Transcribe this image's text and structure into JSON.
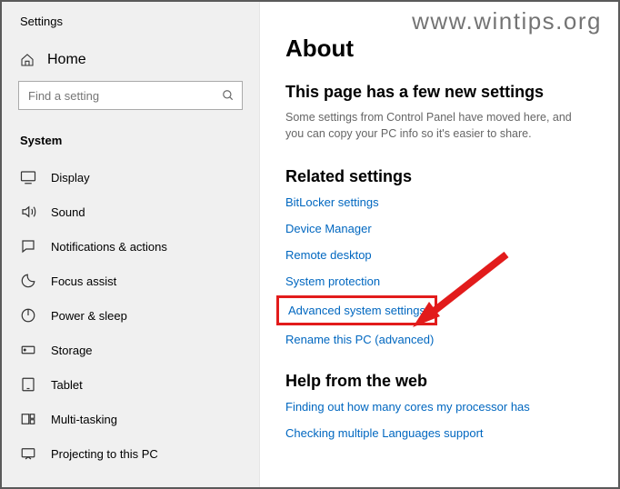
{
  "watermark": "www.wintips.org",
  "sidebar": {
    "title": "Settings",
    "home_label": "Home",
    "search_placeholder": "Find a setting",
    "group_header": "System",
    "items": [
      {
        "label": "Display"
      },
      {
        "label": "Sound"
      },
      {
        "label": "Notifications & actions"
      },
      {
        "label": "Focus assist"
      },
      {
        "label": "Power & sleep"
      },
      {
        "label": "Storage"
      },
      {
        "label": "Tablet"
      },
      {
        "label": "Multi-tasking"
      },
      {
        "label": "Projecting to this PC"
      }
    ]
  },
  "content": {
    "page_title": "About",
    "new_settings_title": "This page has a few new settings",
    "new_settings_text": "Some settings from Control Panel have moved here, and you can copy your PC info so it's easier to share.",
    "related_title": "Related settings",
    "related_links": [
      "BitLocker settings",
      "Device Manager",
      "Remote desktop",
      "System protection",
      "Advanced system settings",
      "Rename this PC (advanced)"
    ],
    "help_title": "Help from the web",
    "help_links": [
      "Finding out how many cores my processor has",
      "Checking multiple Languages support"
    ]
  }
}
